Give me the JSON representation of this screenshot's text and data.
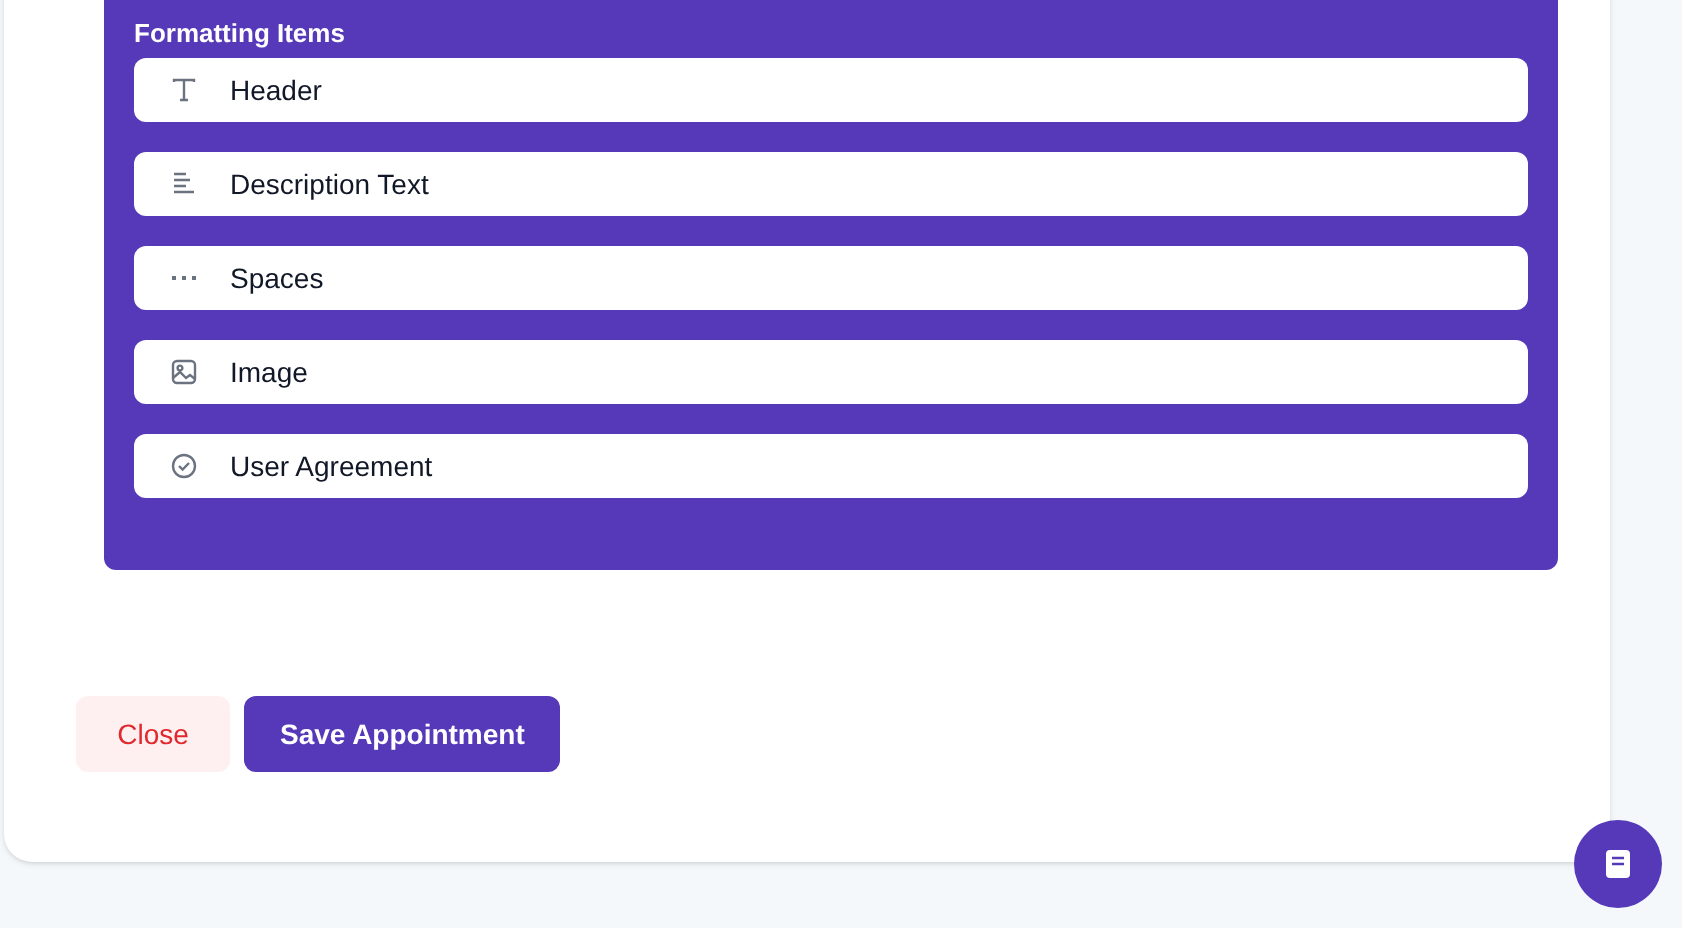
{
  "formatting_panel": {
    "title": "Formatting Items",
    "items": [
      {
        "kind": "header",
        "label": "Header"
      },
      {
        "kind": "description",
        "label": "Description Text"
      },
      {
        "kind": "spaces",
        "label": "Spaces"
      },
      {
        "kind": "image",
        "label": "Image"
      },
      {
        "kind": "agreement",
        "label": "User Agreement"
      }
    ]
  },
  "buttons": {
    "close": "Close",
    "save": "Save Appointment"
  }
}
